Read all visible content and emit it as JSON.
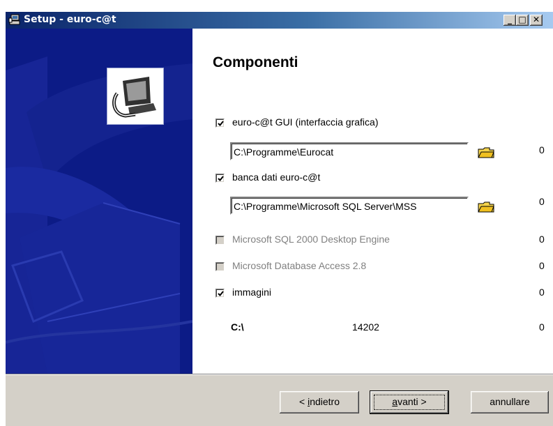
{
  "window": {
    "title": "Setup - euro-c@t",
    "minimize_glyph": "_",
    "maximize_glyph": "□",
    "close_glyph": "✕"
  },
  "page": {
    "heading": "Componenti"
  },
  "components": [
    {
      "label": "euro-c@t GUI (interfaccia grafica)",
      "checked": true,
      "enabled": true,
      "size": "0",
      "path": "C:\\Programme\\Eurocat"
    },
    {
      "label": "banca dati euro-c@t",
      "checked": true,
      "enabled": true,
      "size": "0",
      "path": "C:\\Programme\\Microsoft SQL Server\\MSS"
    },
    {
      "label": "Microsoft SQL 2000 Desktop Engine",
      "checked": false,
      "enabled": false,
      "size": "0"
    },
    {
      "label": "Microsoft Database Access 2.8",
      "checked": false,
      "enabled": false,
      "size": "0"
    },
    {
      "label": "immagini",
      "checked": true,
      "enabled": true,
      "size": "0"
    }
  ],
  "drive": {
    "label": "C:\\",
    "free": "14202",
    "required": "0"
  },
  "buttons": {
    "back_prefix": "< ",
    "back_mnemonic": "i",
    "back_rest": "ndietro",
    "next_mnemonic": "a",
    "next_rest": "vanti >",
    "cancel": "annullare"
  },
  "icons": {
    "title_icon": "setup-computer-icon",
    "logo": "computer-logo-icon",
    "folder": "folder-icon"
  },
  "colors": {
    "sidebar": "#0c1b86",
    "titlebar_start": "#0a246a",
    "titlebar_end": "#a6caf0"
  }
}
